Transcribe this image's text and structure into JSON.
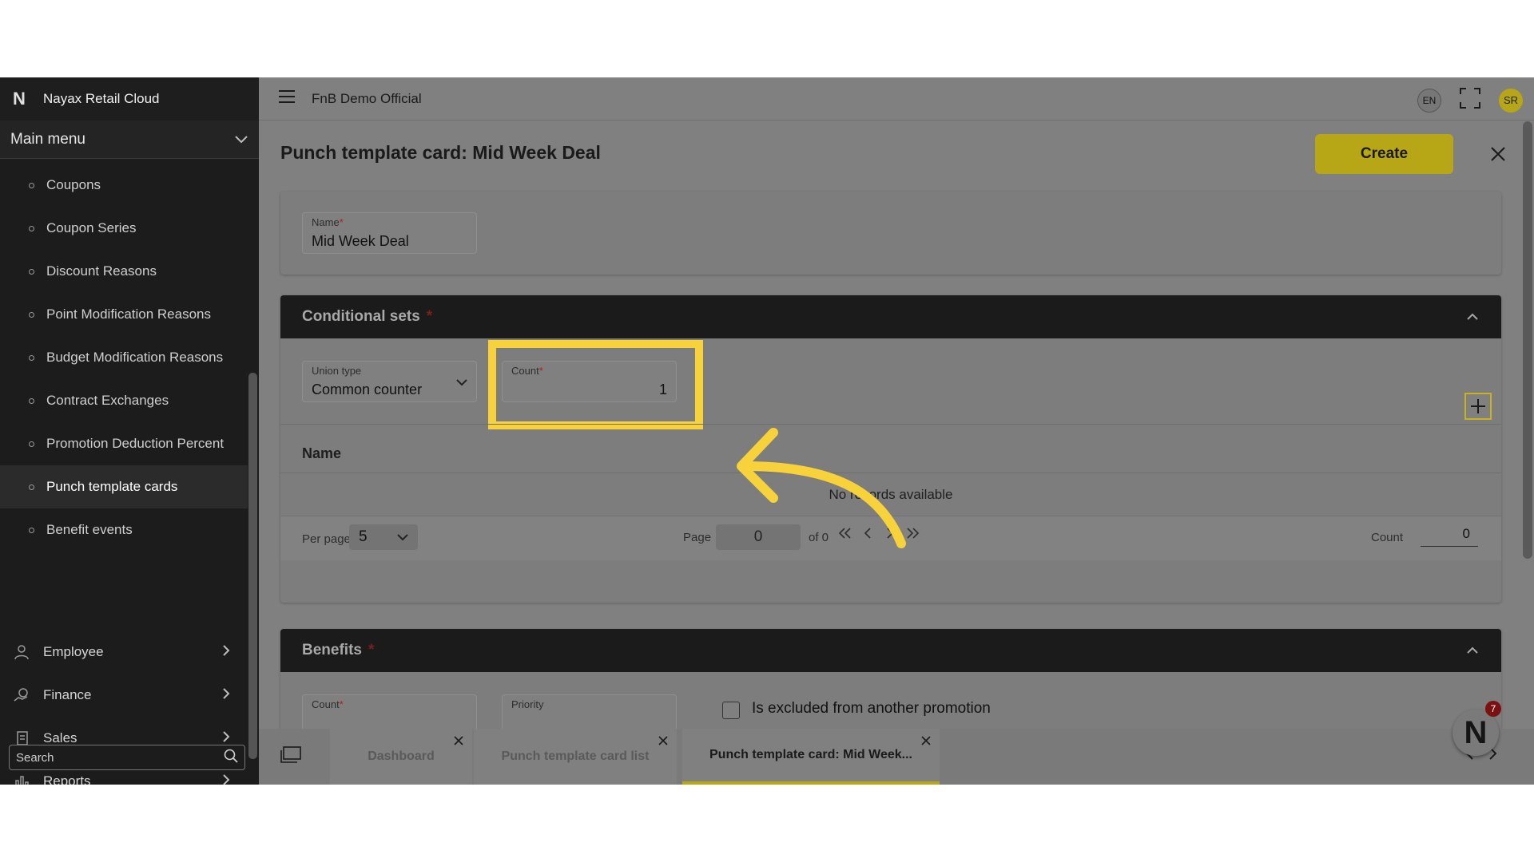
{
  "brand": {
    "name": "Nayax Retail Cloud",
    "logo": "N"
  },
  "sidebar": {
    "main_menu_label": "Main menu",
    "sub_items": [
      {
        "label": "Coupons"
      },
      {
        "label": "Coupon Series"
      },
      {
        "label": "Discount Reasons"
      },
      {
        "label": "Point Modification Reasons"
      },
      {
        "label": "Budget Modification Reasons"
      },
      {
        "label": "Contract Exchanges"
      },
      {
        "label": "Promotion Deduction Percent"
      },
      {
        "label": "Punch template cards",
        "active": true
      },
      {
        "label": "Benefit events"
      }
    ],
    "groups": [
      {
        "label": "Employee",
        "icon": "employee-icon"
      },
      {
        "label": "Finance",
        "icon": "finance-icon"
      },
      {
        "label": "Sales",
        "icon": "sales-icon"
      },
      {
        "label": "Reports",
        "icon": "reports-icon"
      }
    ],
    "search_placeholder": "Search"
  },
  "header": {
    "org_name": "FnB Demo Official",
    "lang": "EN",
    "avatar_initials": "SR"
  },
  "page": {
    "title": "Punch template card: Mid Week Deal",
    "create_label": "Create",
    "name_field": {
      "label": "Name",
      "value": "Mid Week Deal"
    }
  },
  "conditional_sets": {
    "title": "Conditional sets",
    "union_type": {
      "label": "Union type",
      "value": "Common counter"
    },
    "count": {
      "label": "Count",
      "value": "1"
    },
    "column_name": "Name",
    "empty_text": "No records available",
    "per_page_label": "Per page:",
    "per_page_value": "5",
    "page_label": "Page",
    "page_value": "0",
    "of_label": "of 0",
    "count_label": "Count",
    "count_value": "0"
  },
  "benefits": {
    "title": "Benefits",
    "count_label": "Count",
    "priority_label": "Priority",
    "excluded_label": "Is excluded from another promotion"
  },
  "tabs": [
    {
      "label": "Dashboard"
    },
    {
      "label": "Punch template card list"
    },
    {
      "label": "Punch template card: Mid Week...",
      "active": true
    }
  ],
  "fab": {
    "logo": "N",
    "badge": "7"
  },
  "colors": {
    "accent": "#b7a615",
    "highlight": "#f7d23a",
    "sidebar_bg": "#1c1c1c",
    "section_head_bg": "#1b1b1b"
  }
}
